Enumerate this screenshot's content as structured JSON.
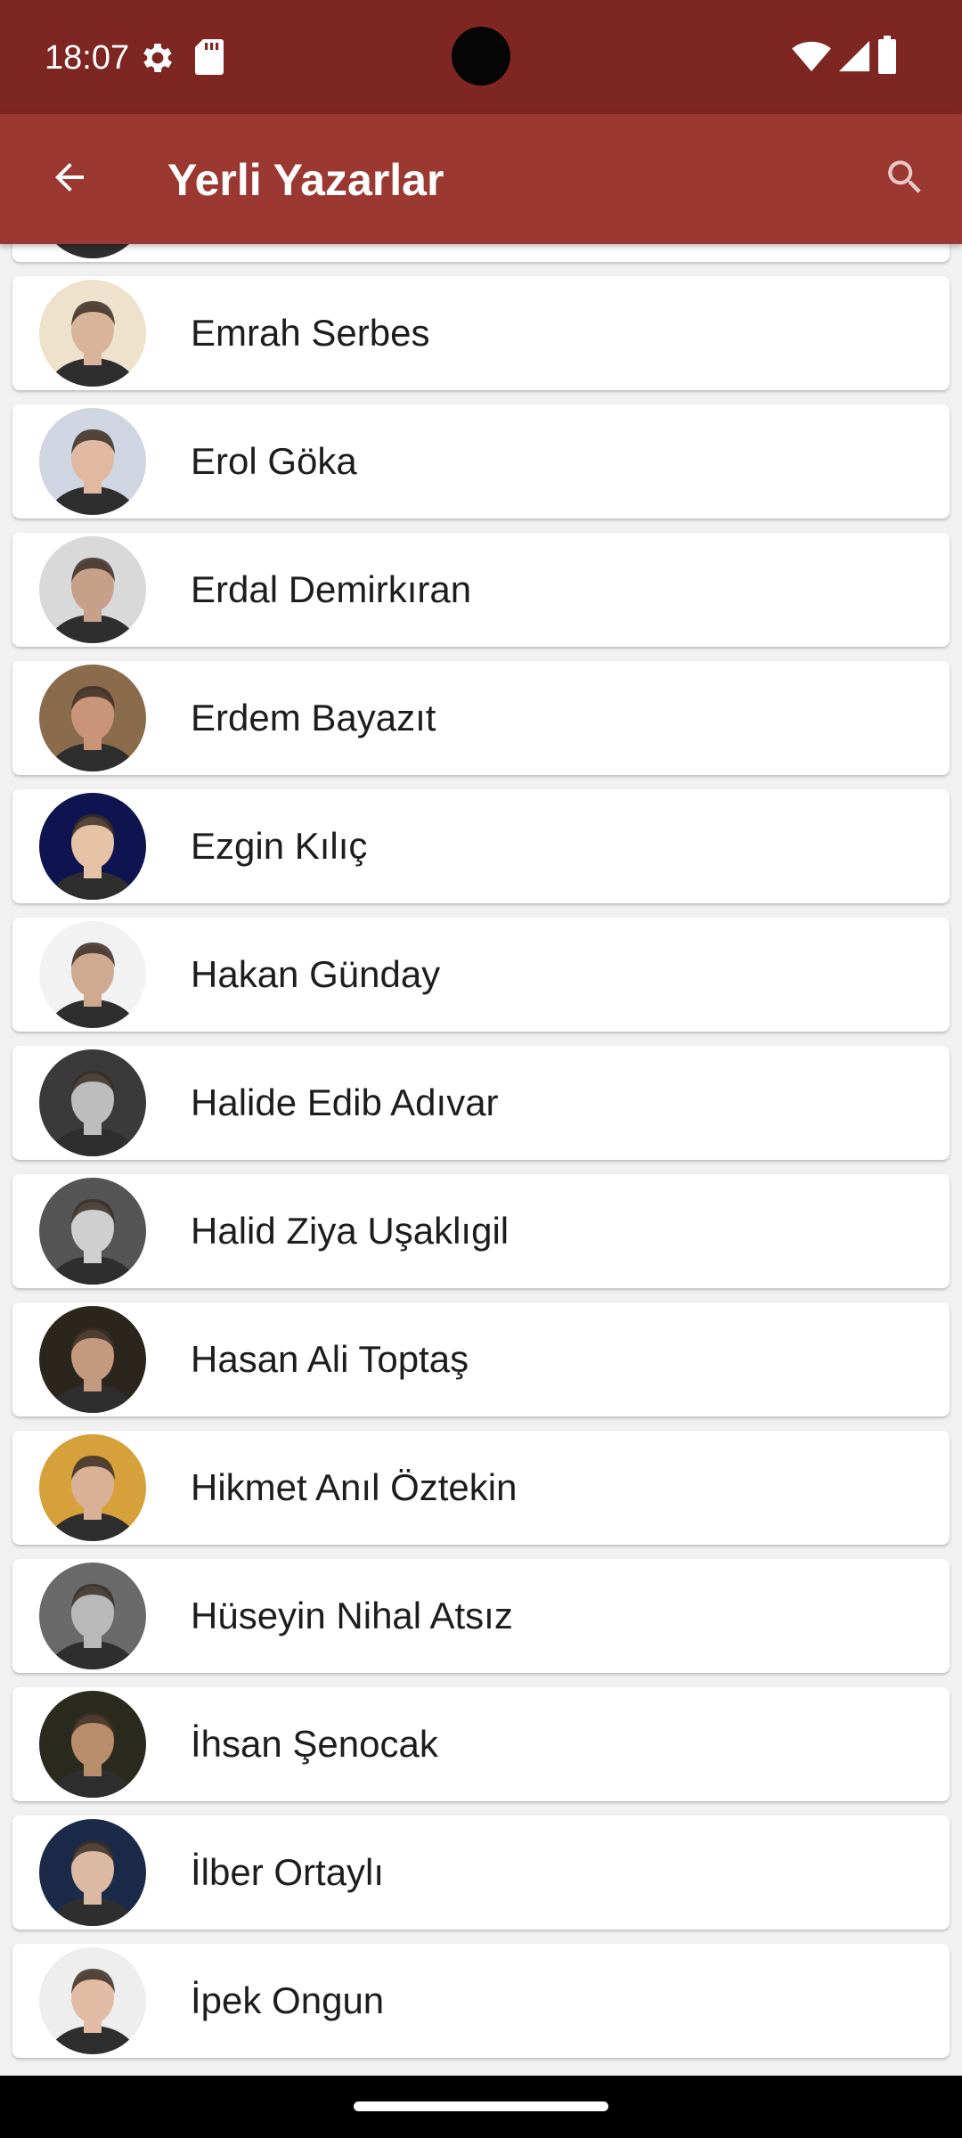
{
  "status_bar": {
    "time": "18:07",
    "left_icons": [
      "settings-icon",
      "sd-card-icon"
    ],
    "right_icons": [
      "wifi-icon",
      "signal-icon",
      "battery-icon"
    ]
  },
  "app_bar": {
    "title": "Yerli Yazarlar",
    "back_icon": "arrow-back-icon",
    "search_icon": "search-icon",
    "background": "#9c3832"
  },
  "authors": [
    {
      "name": "",
      "skin": "#c9967a",
      "bg": "#6b4a3a"
    },
    {
      "name": "Emrah Serbes",
      "skin": "#d8b59a",
      "bg": "#efe2cc"
    },
    {
      "name": "Erol Göka",
      "skin": "#e0b9a0",
      "bg": "#cfd6e2"
    },
    {
      "name": "Erdal Demirkıran",
      "skin": "#c7a08a",
      "bg": "#d9d9d9"
    },
    {
      "name": "Erdem Bayazıt",
      "skin": "#c99478",
      "bg": "#8a6b4c"
    },
    {
      "name": "Ezgin Kılıç",
      "skin": "#e6c3a6",
      "bg": "#0d1450"
    },
    {
      "name": "Hakan Günday",
      "skin": "#cfa990",
      "bg": "#f2f2f2"
    },
    {
      "name": "Halide Edib Adıvar",
      "skin": "#bdbdbd",
      "bg": "#3a3a3a"
    },
    {
      "name": "Halid Ziya Uşaklıgil",
      "skin": "#cfcfcf",
      "bg": "#555555"
    },
    {
      "name": "Hasan Ali Toptaş",
      "skin": "#c39a7e",
      "bg": "#2b261d"
    },
    {
      "name": "Hikmet Anıl Öztekin",
      "skin": "#d9b196",
      "bg": "#d6a13a"
    },
    {
      "name": "Hüseyin Nihal Atsız",
      "skin": "#b9b9b9",
      "bg": "#6a6a6a"
    },
    {
      "name": "İhsan Şenocak",
      "skin": "#b88d6c",
      "bg": "#2a2a1e"
    },
    {
      "name": "İlber Ortaylı",
      "skin": "#dcb9a2",
      "bg": "#1c2a4a"
    },
    {
      "name": "İpek Ongun",
      "skin": "#e2bca4",
      "bg": "#eeeeee"
    }
  ]
}
